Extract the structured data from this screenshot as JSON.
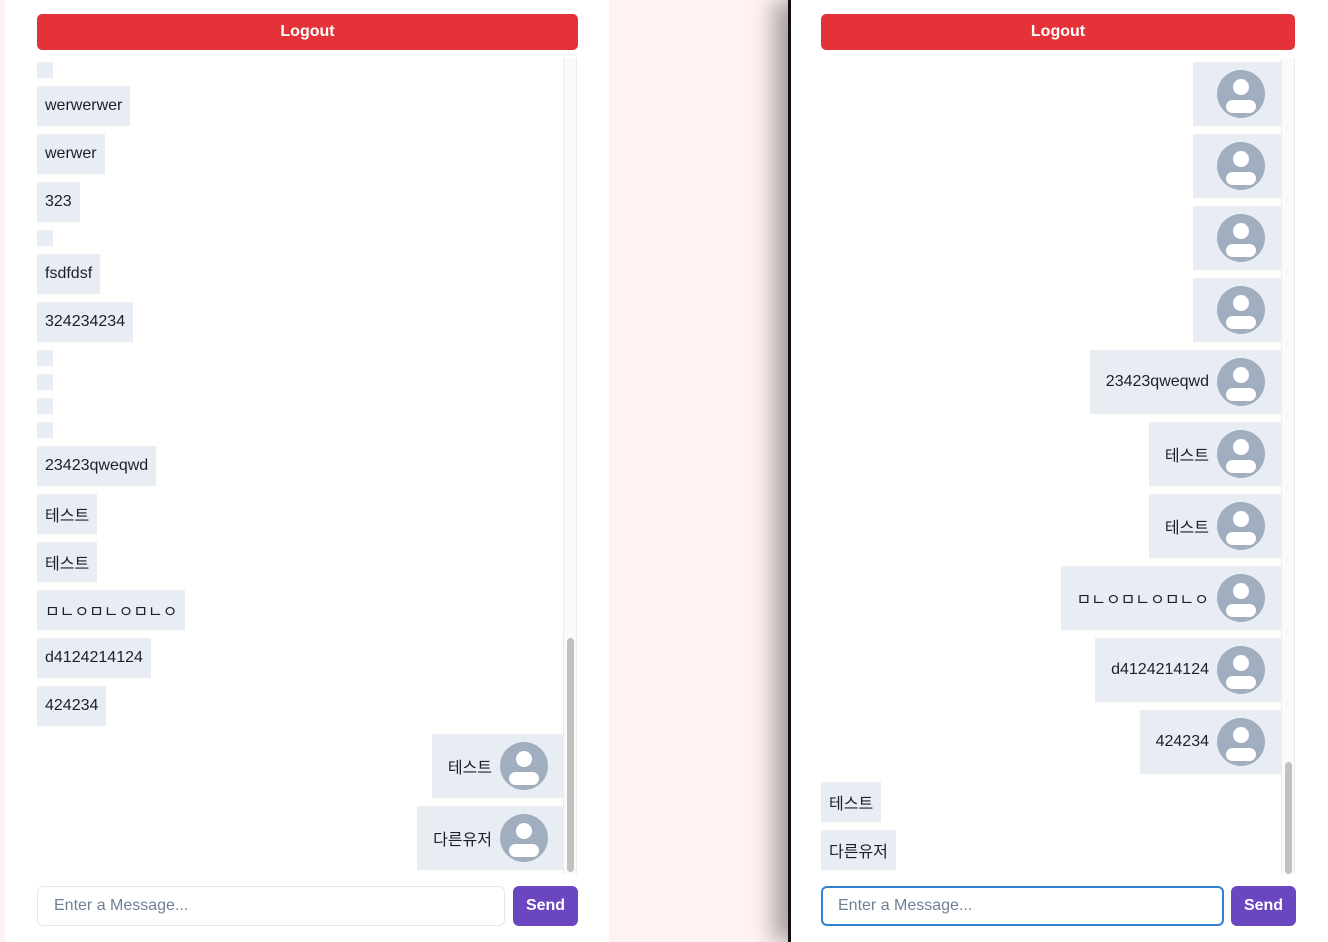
{
  "left_pane": {
    "logout_label": "Logout",
    "messages": [
      "",
      "werwerwer",
      "werwer",
      "323",
      "",
      "fsdfdsf",
      "324234234",
      "",
      "",
      "",
      "",
      "23423qweqwd",
      "테스트",
      "테스트",
      "ㅁㄴㅇㅁㄴㅇㅁㄴㅇ",
      "d4124214124",
      "424234"
    ],
    "own_messages": [
      "테스트",
      "다른유저"
    ],
    "input_placeholder": "Enter a Message...",
    "send_label": "Send"
  },
  "right_pane": {
    "logout_label": "Logout",
    "own_messages": [
      "",
      "",
      "",
      "",
      "23423qweqwd",
      "테스트",
      "테스트",
      "ㅁㄴㅇㅁㄴㅇㅁㄴㅇ",
      "d4124214124",
      "424234"
    ],
    "messages": [
      "테스트",
      "다른유저"
    ],
    "input_placeholder": "Enter a Message...",
    "send_label": "Send"
  },
  "colors": {
    "logout": "#e53238",
    "send": "#6b46c1",
    "bubble": "#e8edf4",
    "avatar": "#a0aec0",
    "focus": "#3182ce",
    "background": "#fff2f2"
  },
  "icons": {
    "avatar": "user-avatar-icon"
  }
}
